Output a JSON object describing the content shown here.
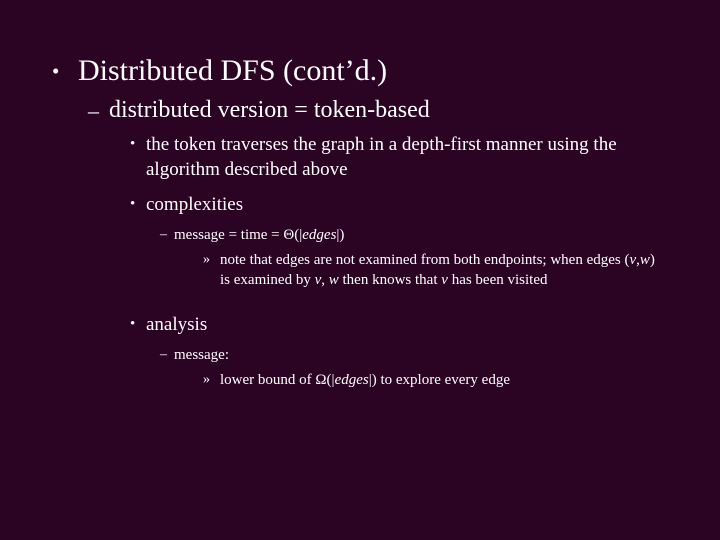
{
  "slide": {
    "background_color": "#2b0424",
    "text_color": "#ffffff",
    "title": "Distributed DFS (cont’d.)",
    "markers": {
      "level1": "•",
      "level2": "–",
      "level3": "•",
      "level4": "–",
      "level5": "»"
    },
    "outline": {
      "l1_title": "Distributed DFS (cont’d.)",
      "l2_version": "distributed version = token-based",
      "l3_token": "the token traverses the graph in a depth-first manner using the algorithm described above",
      "l3_complexities": "complexities",
      "l4_message_time_prefix": "message = time = ",
      "l4_message_time_theta": "Θ(|",
      "l4_message_time_edges": "edges",
      "l4_message_time_suffix": "|)",
      "l5_note_part1": "note that edges are not examined from both endpoints; when edges (",
      "l5_note_v1": "v",
      "l5_note_comma": ",",
      "l5_note_w1": "w",
      "l5_note_part2": ") is examined by ",
      "l5_note_v2": "v",
      "l5_note_part3": ", ",
      "l5_note_w2": "w",
      "l5_note_part4": " then knows that ",
      "l5_note_v3": "v",
      "l5_note_part5": " has been visited",
      "l3_analysis": "analysis",
      "l4_message": "message:",
      "l5_lower_prefix": "lower bound of ",
      "l5_lower_omega": "Ω(|",
      "l5_lower_edges": "edges",
      "l5_lower_suffix": "|) to explore every edge"
    }
  }
}
